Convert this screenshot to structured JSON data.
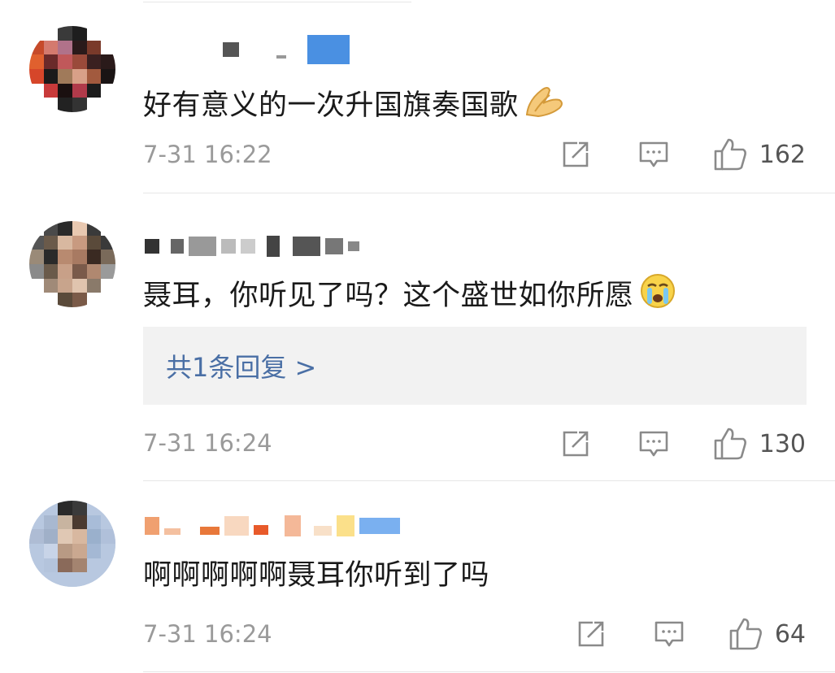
{
  "comments": [
    {
      "text": "好有意义的一次升国旗奏国歌",
      "emoji": "folded-hands-emoji",
      "time": "7-31 16:22",
      "likes": "162"
    },
    {
      "text": "聂耳，你听见了吗？这个盛世如你所愿",
      "emoji": "crying-face-emoji",
      "reply_label": "共1条回复 >",
      "time": "7-31 16:24",
      "likes": "130"
    },
    {
      "text": "啊啊啊啊啊聂耳你听到了吗",
      "time": "7-31 16:24",
      "likes": "64"
    }
  ],
  "icons": {
    "share": "share-icon",
    "comment": "comment-icon",
    "like": "like-icon"
  },
  "colors": {
    "reply_link": "#4a6fa5",
    "meta_text": "#9a9a9a",
    "reply_bg": "#f2f2f2"
  }
}
